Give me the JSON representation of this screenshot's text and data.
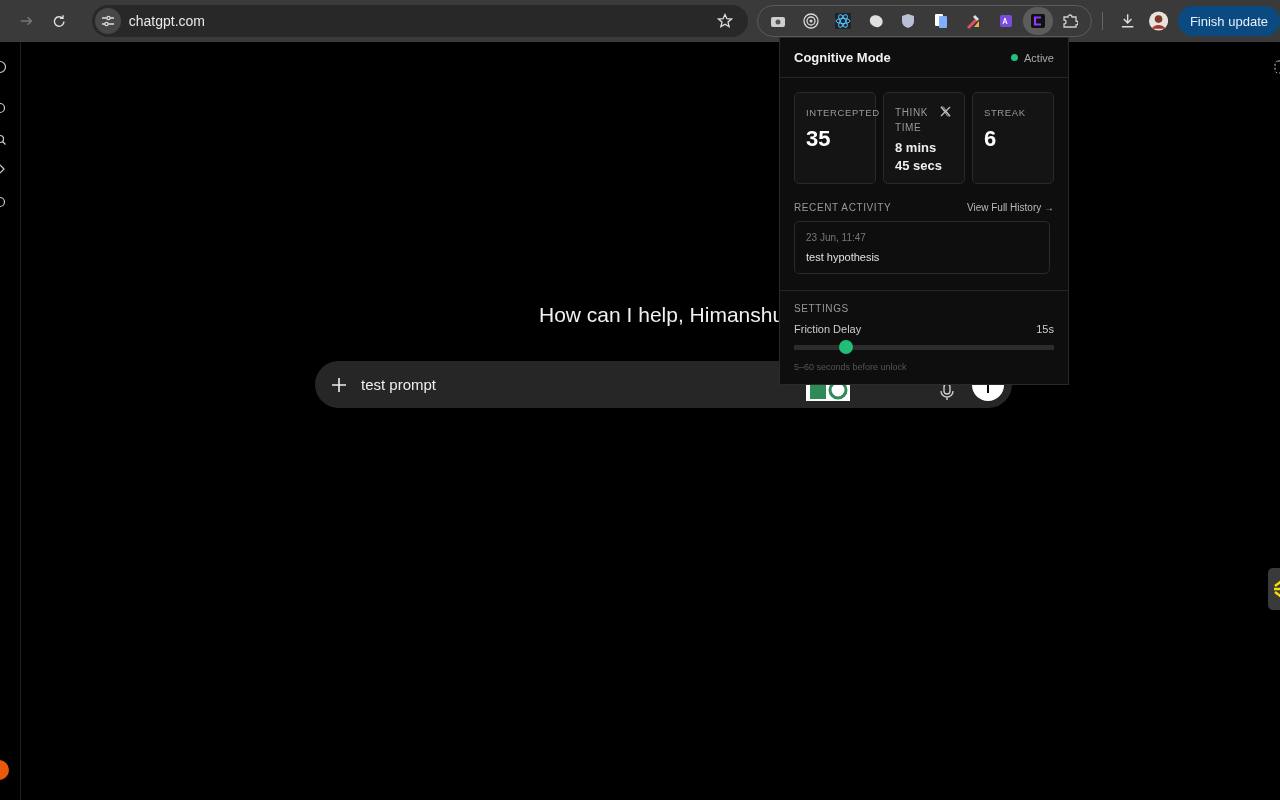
{
  "browser": {
    "forward_disabled": true,
    "url": "chatgpt.com",
    "update_button": "Finish update"
  },
  "extensions": [
    {
      "kind": "camera",
      "selected": false
    },
    {
      "kind": "target",
      "selected": false
    },
    {
      "kind": "atom",
      "selected": false
    },
    {
      "kind": "blob",
      "selected": false
    },
    {
      "kind": "shield",
      "selected": false
    },
    {
      "kind": "doc",
      "selected": false
    },
    {
      "kind": "dropper",
      "selected": false
    },
    {
      "kind": "dict",
      "selected": false
    },
    {
      "kind": "cognitive",
      "selected": true
    },
    {
      "kind": "puzzle",
      "selected": false
    }
  ],
  "chat": {
    "greeting": "How can I help, Himanshu",
    "prompt": "test prompt"
  },
  "popup": {
    "title": "Cognitive Mode",
    "status": {
      "label": "Active",
      "active": true,
      "color": "#22c27a"
    },
    "stats": [
      {
        "label": "INTERCEPTED",
        "value": "35",
        "kind": "big"
      },
      {
        "label": "THINK TIME",
        "value": "8 mins 45 secs",
        "kind": "small"
      },
      {
        "label": "STREAK",
        "value": "6",
        "kind": "big"
      }
    ],
    "recent_heading": "RECENT ACTIVITY",
    "history_link": "View Full History →",
    "activity": [
      {
        "time": "23 Jun, 11:47",
        "text": "test hypothesis"
      }
    ],
    "settings_heading": "SETTINGS",
    "slider": {
      "label": "Friction Delay",
      "reading": "15s",
      "level": 0.2,
      "hint": "5–60 seconds before unlock"
    }
  }
}
